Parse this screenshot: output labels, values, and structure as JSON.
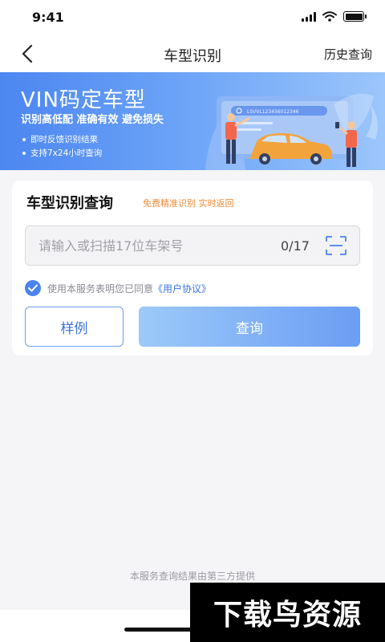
{
  "status": {
    "time": "9:41"
  },
  "nav": {
    "title": "车型识别",
    "history_label": "历史查询"
  },
  "banner": {
    "title": "VIN码定车型",
    "subtitle": "识别高低配 准确有效 避免损失",
    "bullets": [
      "即时反馈识别结果",
      "支持7x24小时查询"
    ],
    "art_vin_text": "LSVVL123456012346"
  },
  "card": {
    "title": "车型识别查询",
    "tag": "免费精准识别 实时返回",
    "input": {
      "placeholder": "请输入或扫描17位车架号",
      "value": "",
      "counter": "0/17"
    },
    "agreement": {
      "text": "使用本服务表明您已同意",
      "link": "《用户协议》",
      "checked": true
    },
    "sample_label": "样例",
    "query_label": "查询"
  },
  "footer": {
    "note": "本服务查询结果由第三方提供"
  },
  "watermark": {
    "text": "下载鸟资源"
  },
  "colors": {
    "primary": "#4a82ee",
    "accent_orange": "#f08b3a",
    "banner_start": "#4c86f0",
    "banner_end": "#9cc6fb"
  }
}
